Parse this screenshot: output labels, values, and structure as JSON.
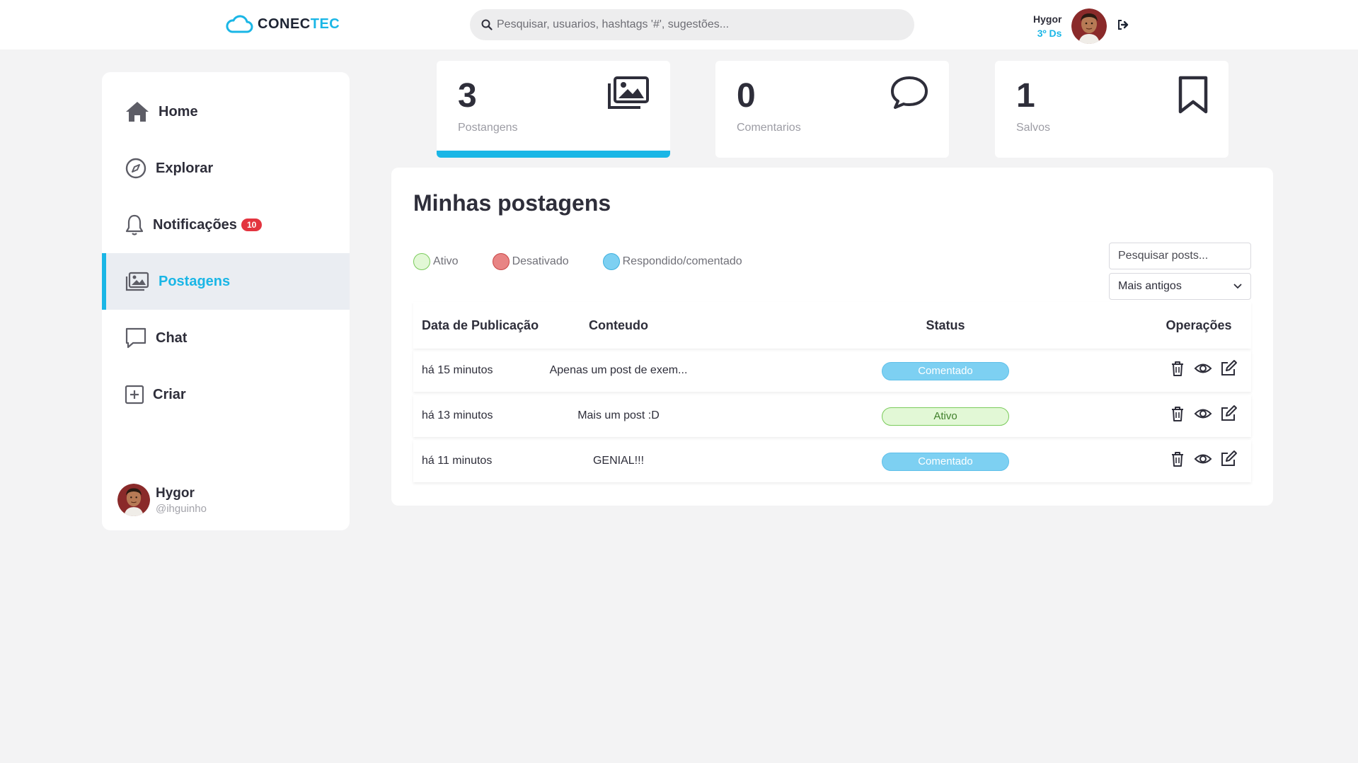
{
  "header": {
    "logo_main": "CONEC",
    "logo_accent": "TEC",
    "search_placeholder": "Pesquisar, usuarios, hashtags '#', sugestões...",
    "user_name": "Hygor",
    "user_class": "3º Ds"
  },
  "sidebar": {
    "items": [
      {
        "label": "Home",
        "icon": "home-icon"
      },
      {
        "label": "Explorar",
        "icon": "compass-icon"
      },
      {
        "label": "Notificações",
        "icon": "bell-icon",
        "badge": "10"
      },
      {
        "label": "Postagens",
        "icon": "images-icon",
        "active": true
      },
      {
        "label": "Chat",
        "icon": "chat-icon"
      },
      {
        "label": "Criar",
        "icon": "plus-square-icon"
      }
    ],
    "user": {
      "name": "Hygor",
      "handle": "@ihguinho"
    }
  },
  "stats": [
    {
      "value": "3",
      "label": "Postangens",
      "icon": "images-icon"
    },
    {
      "value": "0",
      "label": "Comentarios",
      "icon": "comment-icon"
    },
    {
      "value": "1",
      "label": "Salvos",
      "icon": "bookmark-icon"
    }
  ],
  "main": {
    "title": "Minhas postagens",
    "legend": [
      {
        "label": "Ativo",
        "color": "#e2f8d6"
      },
      {
        "label": "Desativado",
        "color": "#e88484"
      },
      {
        "label": "Respondido/comentado",
        "color": "#7dd0f2"
      }
    ],
    "search_placeholder": "Pesquisar posts...",
    "sort_value": "Mais antigos",
    "columns": [
      "Data de Publicação",
      "Conteudo",
      "Status",
      "Operações"
    ],
    "rows": [
      {
        "date": "há 15 minutos",
        "content": "Apenas um post de exem...",
        "status": "Comentado"
      },
      {
        "date": "há 13 minutos",
        "content": "Mais um post :D",
        "status": "Ativo"
      },
      {
        "date": "há 11 minutos",
        "content": "GENIAL!!!",
        "status": "Comentado"
      }
    ]
  },
  "colors": {
    "accent": "#1ab6e6",
    "badge": "#e3343f",
    "background": "#f3f3f4"
  }
}
